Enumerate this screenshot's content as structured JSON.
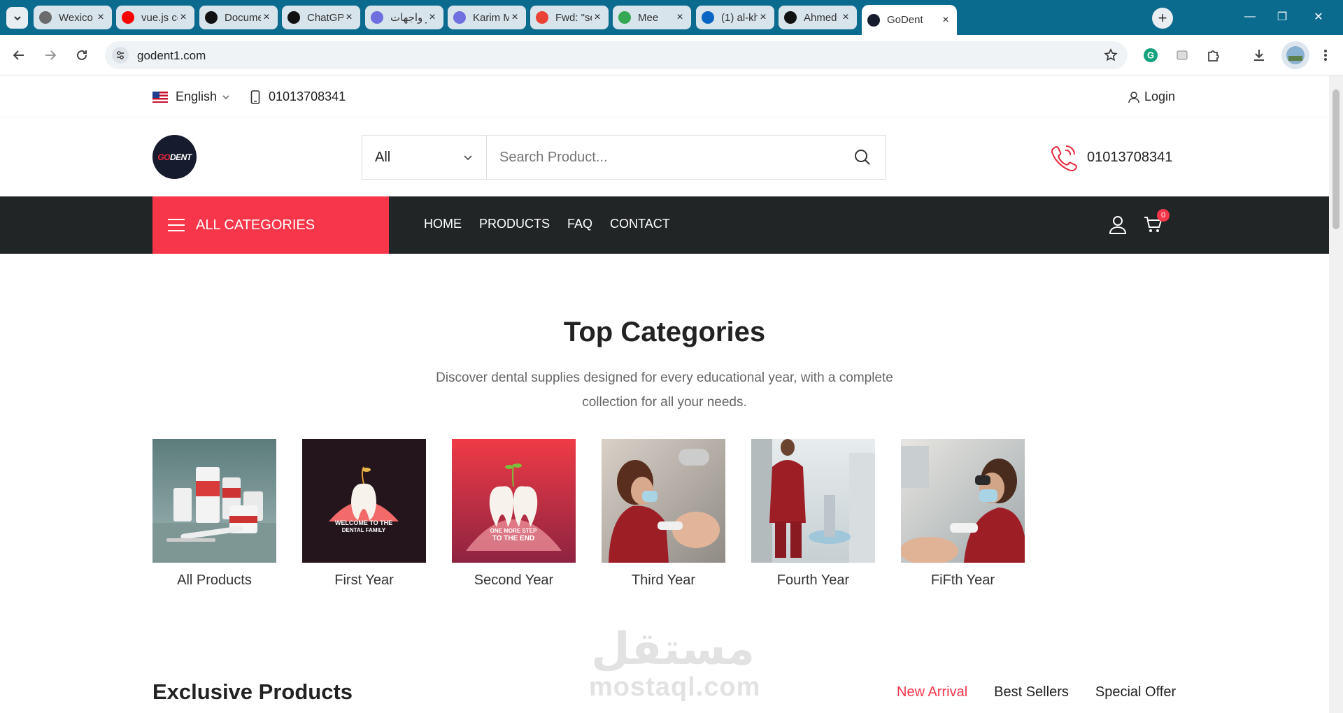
{
  "browser": {
    "tabs": [
      {
        "title": "Wexico -",
        "fav_color": "#6b6b6b"
      },
      {
        "title": "vue.js co",
        "fav_color": "#ff0000"
      },
      {
        "title": "Docume",
        "fav_color": "#111111"
      },
      {
        "title": "ChatGPT",
        "fav_color": "#111111"
      },
      {
        "title": "مطور واجهات",
        "fav_color": "#6f6fe0"
      },
      {
        "title": "Karim M",
        "fav_color": "#6f6fe0"
      },
      {
        "title": "Fwd: \"se",
        "fav_color": "#ea4335"
      },
      {
        "title": "Mee",
        "fav_color": "#34a853"
      },
      {
        "title": "(1) al-kh",
        "fav_color": "#0a66c2"
      },
      {
        "title": "Ahmed I",
        "fav_color": "#111111"
      },
      {
        "title": "GoDent",
        "fav_color": "#161b2e"
      }
    ],
    "url": "godent1.com"
  },
  "topbar": {
    "language": "English",
    "phone": "01013708341",
    "login": "Login"
  },
  "header": {
    "logo_text_a": "GO",
    "logo_text_b": "DENT",
    "category_select": "All",
    "search_placeholder": "Search Product...",
    "phone": "01013708341"
  },
  "nav": {
    "all_categories": "ALL CATEGORIES",
    "links": [
      "HOME",
      "PRODUCTS",
      "FAQ",
      "CONTACT"
    ],
    "cart_count": "0"
  },
  "categories": {
    "title": "Top Categories",
    "subtitle": "Discover dental supplies designed for every educational year, with a complete collection for all your needs.",
    "items": [
      {
        "label": "All Products"
      },
      {
        "label": "First Year",
        "image_text": "WELCOME TO THE DENTAL FAMILY"
      },
      {
        "label": "Second Year",
        "image_text": "ONE MORE STEP TO THE END"
      },
      {
        "label": "Third Year"
      },
      {
        "label": "Fourth Year"
      },
      {
        "label": "FiFth Year"
      }
    ]
  },
  "exclusive": {
    "title": "Exclusive Products",
    "tabs": [
      "New Arrival",
      "Best Sellers",
      "Special Offer"
    ],
    "active_tab": "New Arrival"
  },
  "watermark": {
    "arabic": "مستقل",
    "latin": "mostaql.com"
  },
  "colors": {
    "accent": "#f7364a",
    "nav_bg": "#222526",
    "chrome": "#0b6b8f"
  }
}
